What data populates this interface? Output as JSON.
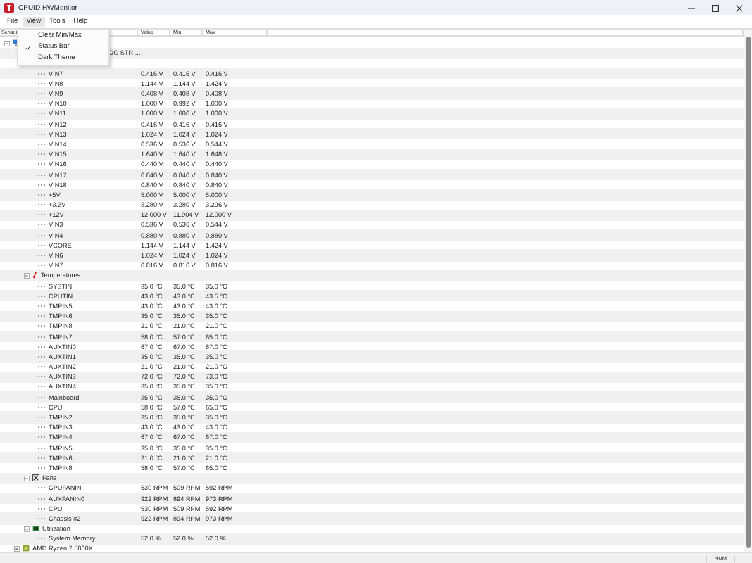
{
  "window": {
    "title": "CPUID HWMonitor"
  },
  "menu_bar": [
    {
      "label": "File",
      "selected": false
    },
    {
      "label": "View",
      "selected": true
    },
    {
      "label": "Tools",
      "selected": false
    },
    {
      "label": "Help",
      "selected": false
    }
  ],
  "open_menu": {
    "items": [
      {
        "label": "Clear Min/Max",
        "checked": false
      },
      {
        "label": "Status Bar",
        "checked": true
      },
      {
        "label": "Dark Theme",
        "checked": false
      }
    ]
  },
  "columns": [
    "Sensor",
    "Value",
    "Min",
    "Max"
  ],
  "tree": [
    {
      "kind": "computer",
      "expanded": true,
      "children": [
        {
          "kind": "board",
          "label": "OG STRI...",
          "children": [
            {
              "kind": "hidden",
              "children": [
                {
                  "label": "VIN7",
                  "value": "0.416 V",
                  "min": "0.416 V",
                  "max": "0.416 V"
                },
                {
                  "label": "VIN8",
                  "value": "1.144 V",
                  "min": "1.144 V",
                  "max": "1.424 V"
                },
                {
                  "label": "VIN9",
                  "value": "0.408 V",
                  "min": "0.408 V",
                  "max": "0.408 V"
                },
                {
                  "label": "VIN10",
                  "value": "1.000 V",
                  "min": "0.992 V",
                  "max": "1.000 V"
                },
                {
                  "label": "VIN11",
                  "value": "1.000 V",
                  "min": "1.000 V",
                  "max": "1.000 V"
                },
                {
                  "label": "VIN12",
                  "value": "0.416 V",
                  "min": "0.416 V",
                  "max": "0.416 V"
                },
                {
                  "label": "VIN13",
                  "value": "1.024 V",
                  "min": "1.024 V",
                  "max": "1.024 V"
                },
                {
                  "label": "VIN14",
                  "value": "0.536 V",
                  "min": "0.536 V",
                  "max": "0.544 V"
                },
                {
                  "label": "VIN15",
                  "value": "1.640 V",
                  "min": "1.640 V",
                  "max": "1.648 V"
                },
                {
                  "label": "VIN16",
                  "value": "0.440 V",
                  "min": "0.440 V",
                  "max": "0.440 V"
                },
                {
                  "label": "VIN17",
                  "value": "0.840 V",
                  "min": "0.840 V",
                  "max": "0.840 V"
                },
                {
                  "label": "VIN18",
                  "value": "0.840 V",
                  "min": "0.840 V",
                  "max": "0.840 V"
                },
                {
                  "label": "+5V",
                  "value": "5.000 V",
                  "min": "5.000 V",
                  "max": "5.000 V"
                },
                {
                  "label": "+3.3V",
                  "value": "3.280 V",
                  "min": "3.280 V",
                  "max": "3.296 V"
                },
                {
                  "label": "+12V",
                  "value": "12.000 V",
                  "min": "11.904 V",
                  "max": "12.000 V"
                },
                {
                  "label": "VIN3",
                  "value": "0.536 V",
                  "min": "0.536 V",
                  "max": "0.544 V"
                },
                {
                  "label": "VIN4",
                  "value": "0.880 V",
                  "min": "0.880 V",
                  "max": "0.880 V"
                },
                {
                  "label": "VCORE",
                  "value": "1.144 V",
                  "min": "1.144 V",
                  "max": "1.424 V"
                },
                {
                  "label": "VIN6",
                  "value": "1.024 V",
                  "min": "1.024 V",
                  "max": "1.024 V"
                },
                {
                  "label": "VIN7",
                  "value": "0.816 V",
                  "min": "0.816 V",
                  "max": "0.816 V"
                }
              ]
            },
            {
              "kind": "temperatures",
              "label": "Temperatures",
              "expanded": true,
              "children": [
                {
                  "label": "SYSTIN",
                  "value": "35.0 °C",
                  "min": "35.0 °C",
                  "max": "35.0 °C"
                },
                {
                  "label": "CPUTIN",
                  "value": "43.0 °C",
                  "min": "43.0 °C",
                  "max": "43.5 °C"
                },
                {
                  "label": "TMPIN5",
                  "value": "43.0 °C",
                  "min": "43.0 °C",
                  "max": "43.0 °C"
                },
                {
                  "label": "TMPIN6",
                  "value": "35.0 °C",
                  "min": "35.0 °C",
                  "max": "35.0 °C"
                },
                {
                  "label": "TMPIN8",
                  "value": "21.0 °C",
                  "min": "21.0 °C",
                  "max": "21.0 °C"
                },
                {
                  "label": "TMPIN7",
                  "value": "58.0 °C",
                  "min": "57.0 °C",
                  "max": "65.0 °C"
                },
                {
                  "label": "AUXTIN0",
                  "value": "67.0 °C",
                  "min": "67.0 °C",
                  "max": "67.0 °C"
                },
                {
                  "label": "AUXTIN1",
                  "value": "35.0 °C",
                  "min": "35.0 °C",
                  "max": "35.0 °C"
                },
                {
                  "label": "AUXTIN2",
                  "value": "21.0 °C",
                  "min": "21.0 °C",
                  "max": "21.0 °C"
                },
                {
                  "label": "AUXTIN3",
                  "value": "72.0 °C",
                  "min": "72.0 °C",
                  "max": "73.0 °C"
                },
                {
                  "label": "AUXTIN4",
                  "value": "35.0 °C",
                  "min": "35.0 °C",
                  "max": "35.0 °C"
                },
                {
                  "label": "Mainboard",
                  "value": "35.0 °C",
                  "min": "35.0 °C",
                  "max": "35.0 °C"
                },
                {
                  "label": "CPU",
                  "value": "58.0 °C",
                  "min": "57.0 °C",
                  "max": "65.0 °C"
                },
                {
                  "label": "TMPIN2",
                  "value": "35.0 °C",
                  "min": "35.0 °C",
                  "max": "35.0 °C"
                },
                {
                  "label": "TMPIN3",
                  "value": "43.0 °C",
                  "min": "43.0 °C",
                  "max": "43.0 °C"
                },
                {
                  "label": "TMPIN4",
                  "value": "67.0 °C",
                  "min": "67.0 °C",
                  "max": "67.0 °C"
                },
                {
                  "label": "TMPIN5",
                  "value": "35.0 °C",
                  "min": "35.0 °C",
                  "max": "35.0 °C"
                },
                {
                  "label": "TMPIN6",
                  "value": "21.0 °C",
                  "min": "21.0 °C",
                  "max": "21.0 °C"
                },
                {
                  "label": "TMPIN8",
                  "value": "58.0 °C",
                  "min": "57.0 °C",
                  "max": "65.0 °C"
                }
              ]
            },
            {
              "kind": "fans",
              "label": "Fans",
              "expanded": true,
              "children": [
                {
                  "label": "CPUFANIN",
                  "value": "530 RPM",
                  "min": "509 RPM",
                  "max": "592 RPM"
                },
                {
                  "label": "AUXFANIN0",
                  "value": "922 RPM",
                  "min": "894 RPM",
                  "max": "973 RPM"
                },
                {
                  "label": "CPU",
                  "value": "530 RPM",
                  "min": "509 RPM",
                  "max": "592 RPM"
                },
                {
                  "label": "Chassis #2",
                  "value": "922 RPM",
                  "min": "894 RPM",
                  "max": "973 RPM"
                }
              ]
            },
            {
              "kind": "utilization",
              "label": "Utilization",
              "expanded": true,
              "children": [
                {
                  "label": "System Memory",
                  "value": "52.0 %",
                  "min": "52.0 %",
                  "max": "52.0 %"
                }
              ]
            }
          ]
        },
        {
          "kind": "cpu",
          "label": "AMD Ryzen 7 5800X",
          "expanded": false
        }
      ]
    }
  ],
  "status_bar": {
    "indicator": "NUM"
  }
}
